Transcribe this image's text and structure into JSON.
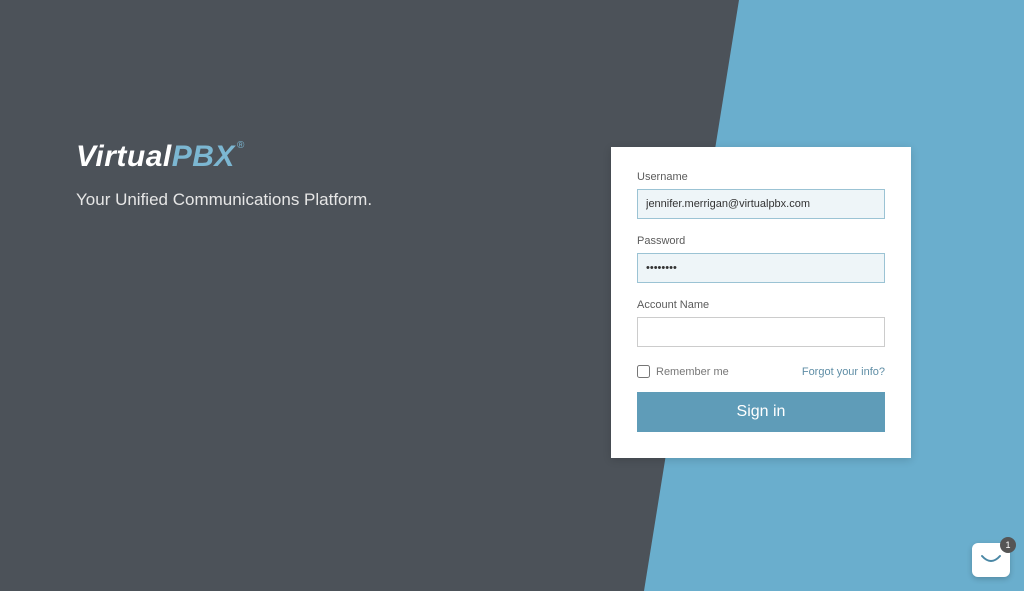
{
  "brand": {
    "logo_part1": "Virtual",
    "logo_part2": "PBX",
    "logo_reg": "®",
    "tagline": "Your Unified Communications Platform."
  },
  "login": {
    "username_label": "Username",
    "username_value": "jennifer.merrigan@virtualpbx.com",
    "password_label": "Password",
    "password_value": "••••••••",
    "account_label": "Account Name",
    "account_value": "",
    "remember_label": "Remember me",
    "forgot_label": "Forgot your info?",
    "signin_label": "Sign in"
  },
  "chat": {
    "badge_count": "1"
  }
}
